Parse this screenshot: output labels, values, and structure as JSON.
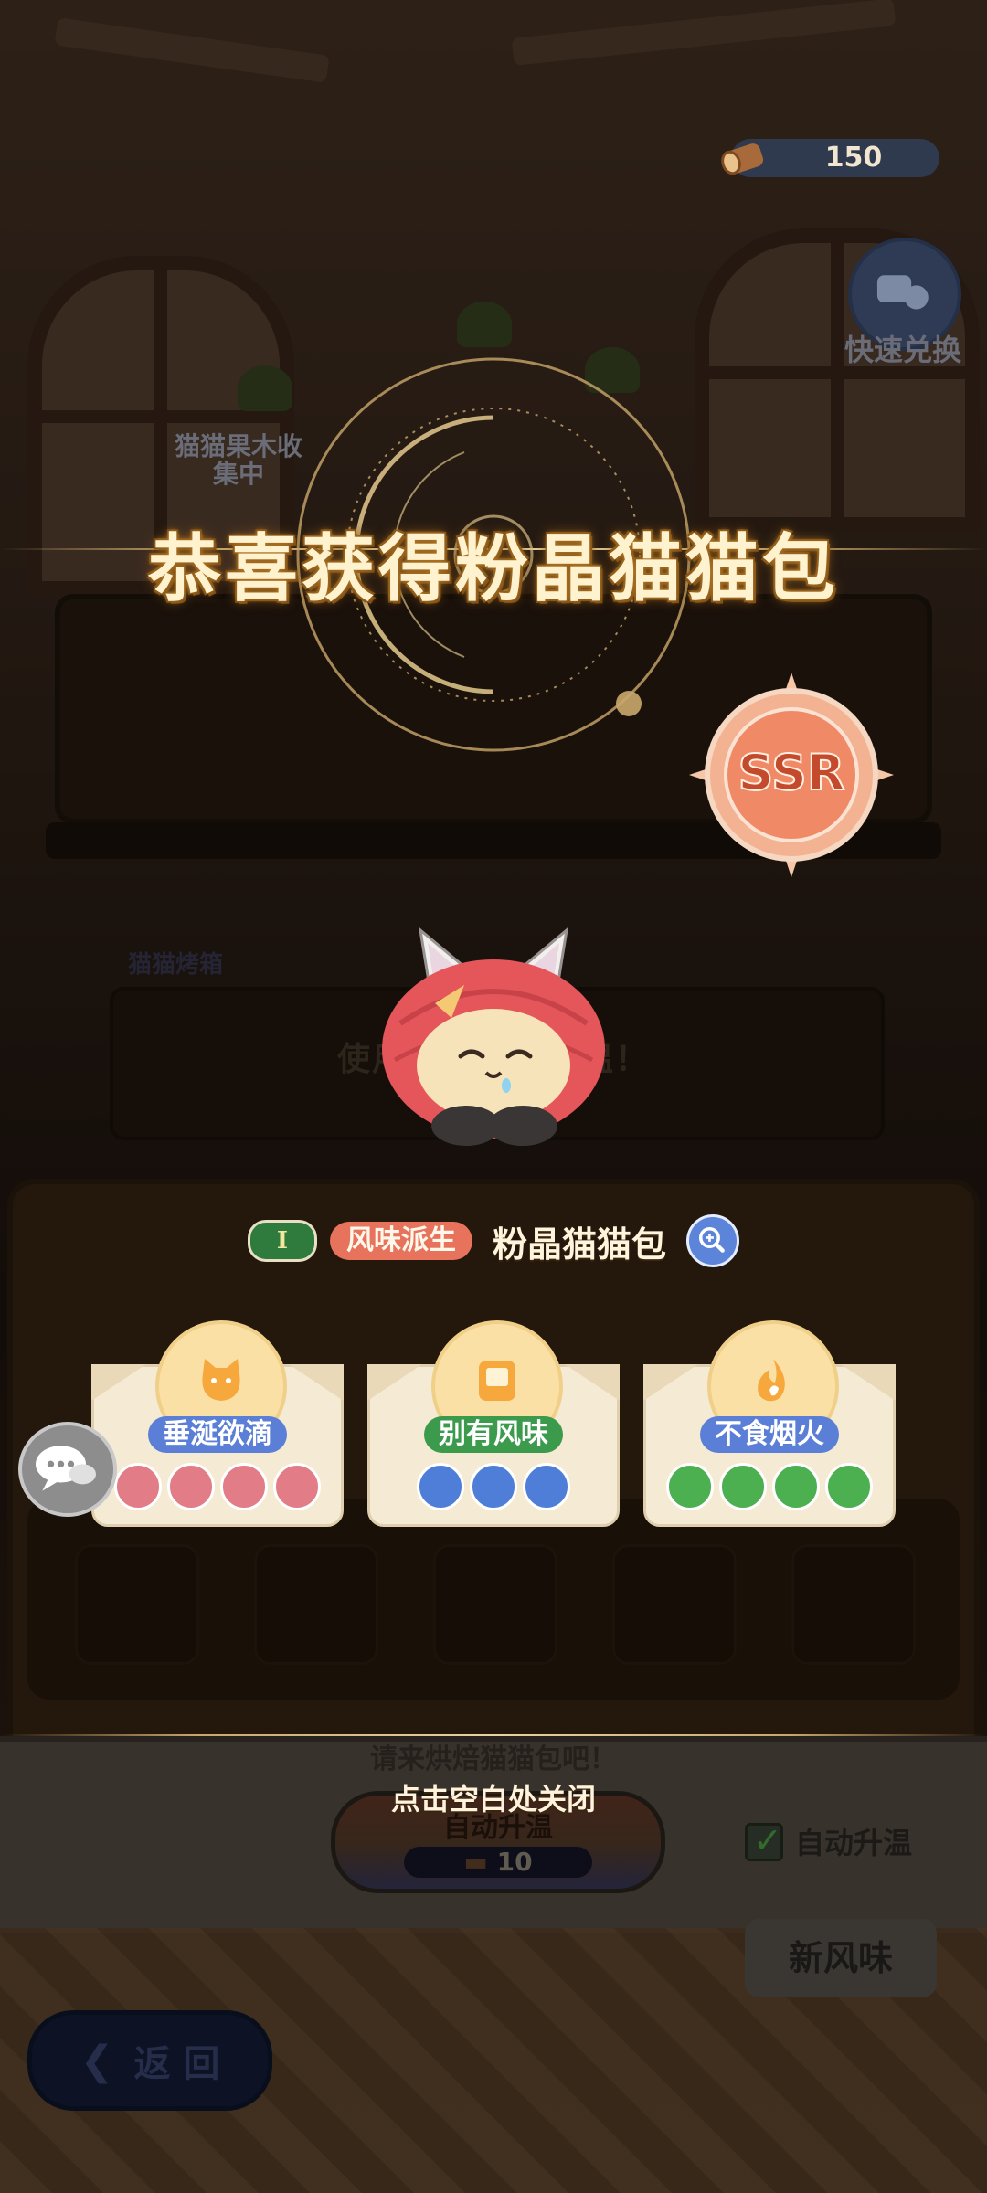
{
  "hud": {
    "currency_value": "150",
    "currency_icon": "wood-log-icon",
    "quick_exchange_label": "快速兑换",
    "fruit_badge_label": "猫猫果木收集中"
  },
  "reward": {
    "title": "恭喜获得粉晶猫猫包",
    "rarity": "SSR",
    "tier": "I",
    "source_tag": "风味派生",
    "item_name": "粉晶猫猫包",
    "close_hint": "点击空白处关闭"
  },
  "traits": [
    {
      "label": "垂涎欲滴",
      "icon": "cat-face-icon",
      "color": "#5b7fd6",
      "dot_color": "#e27c86",
      "dots": 4
    },
    {
      "label": "别有风味",
      "icon": "tablet-icon",
      "color": "#3c9a4c",
      "dot_color": "#4f7ed8",
      "dots": 3
    },
    {
      "label": "不食烟火",
      "icon": "flame-icon",
      "color": "#5b7fd6",
      "dot_color": "#4caf50",
      "dots": 4
    }
  ],
  "background": {
    "oven_label": "猫猫烤箱",
    "oven_hint": "使用猫猫果木升温！",
    "bake_hint": "请来烘焙猫猫包吧！",
    "auto_heat_button": "自动升温",
    "auto_heat_cost": "10",
    "auto_heat_checkbox": "自动升温",
    "auto_heat_checked": true,
    "new_flavor_button": "新风味",
    "back_button": "返 回"
  }
}
